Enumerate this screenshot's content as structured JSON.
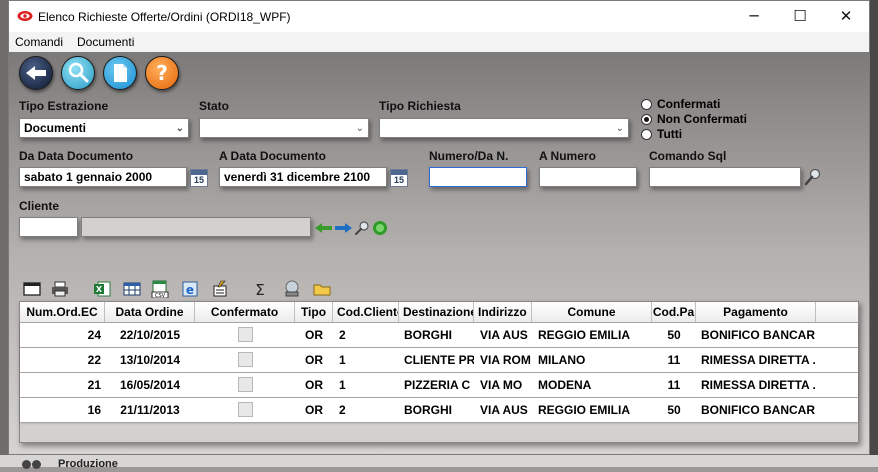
{
  "window": {
    "title": "Elenco Richieste Offerte/Ordini (ORDI18_WPF)",
    "controls": {
      "minimize": "─",
      "maximize": "☐",
      "close": "✕"
    }
  },
  "menu": {
    "items": [
      "Comandi",
      "Documenti"
    ]
  },
  "filters": {
    "tipo_estrazione": {
      "label": "Tipo Estrazione",
      "value": "Documenti"
    },
    "stato": {
      "label": "Stato",
      "value": ""
    },
    "tipo_richiesta": {
      "label": "Tipo Richiesta",
      "value": ""
    },
    "da_data": {
      "label": "Da Data Documento",
      "value": "sabato 1 gennaio 2000"
    },
    "a_data": {
      "label": "A Data Documento",
      "value": "venerdì 31 dicembre 2100"
    },
    "numero_da": {
      "label": "Numero/Da N.",
      "value": ""
    },
    "a_numero": {
      "label": "A Numero",
      "value": ""
    },
    "comando_sql": {
      "label": "Comando Sql",
      "value": ""
    },
    "cliente": {
      "label": "Cliente",
      "code": "",
      "name": ""
    },
    "calendar_badge": "15",
    "radio": {
      "options": [
        "Confermati",
        "Non Confermati",
        "Tutti"
      ],
      "selected": "Non Confermati"
    }
  },
  "grid": {
    "columns": [
      "Num.Ord.EC",
      "Data Ordine",
      "Confermato",
      "Tipo",
      "Cod.Cliente",
      "Destinazione",
      "Indirizzo",
      "Comune",
      "Cod.Pa",
      "Pagamento"
    ],
    "rows": [
      {
        "num": "24",
        "data": "22/10/2015",
        "confermato": false,
        "tipo": "OR",
        "cod_cliente": "2",
        "destinazione": "BORGHI",
        "indirizzo": "VIA AUS",
        "comune": "REGGIO EMILIA",
        "cod_pa": "50",
        "pagamento": "BONIFICO BANCAR"
      },
      {
        "num": "22",
        "data": "13/10/2014",
        "confermato": false,
        "tipo": "OR",
        "cod_cliente": "1",
        "destinazione": "CLIENTE PR",
        "indirizzo": "VIA ROM",
        "comune": "MILANO",
        "cod_pa": "11",
        "pagamento": "RIMESSA DIRETTA ."
      },
      {
        "num": "21",
        "data": "16/05/2014",
        "confermato": false,
        "tipo": "OR",
        "cod_cliente": "1",
        "destinazione": "PIZZERIA C",
        "indirizzo": "VIA MO",
        "comune": "MODENA",
        "cod_pa": "11",
        "pagamento": "RIMESSA DIRETTA ."
      },
      {
        "num": "16",
        "data": "21/11/2013",
        "confermato": false,
        "tipo": "OR",
        "cod_cliente": "2",
        "destinazione": "BORGHI",
        "indirizzo": "VIA AUS",
        "comune": "REGGIO EMILIA",
        "cod_pa": "50",
        "pagamento": "BONIFICO BANCAR"
      }
    ]
  },
  "background": {
    "taskbar_item": "Produzione"
  },
  "colors": {
    "back_button": "#1f2d4a",
    "search_button": "#3fb2d6",
    "doc_button": "#27a3e0",
    "help_button": "#f07a16"
  }
}
